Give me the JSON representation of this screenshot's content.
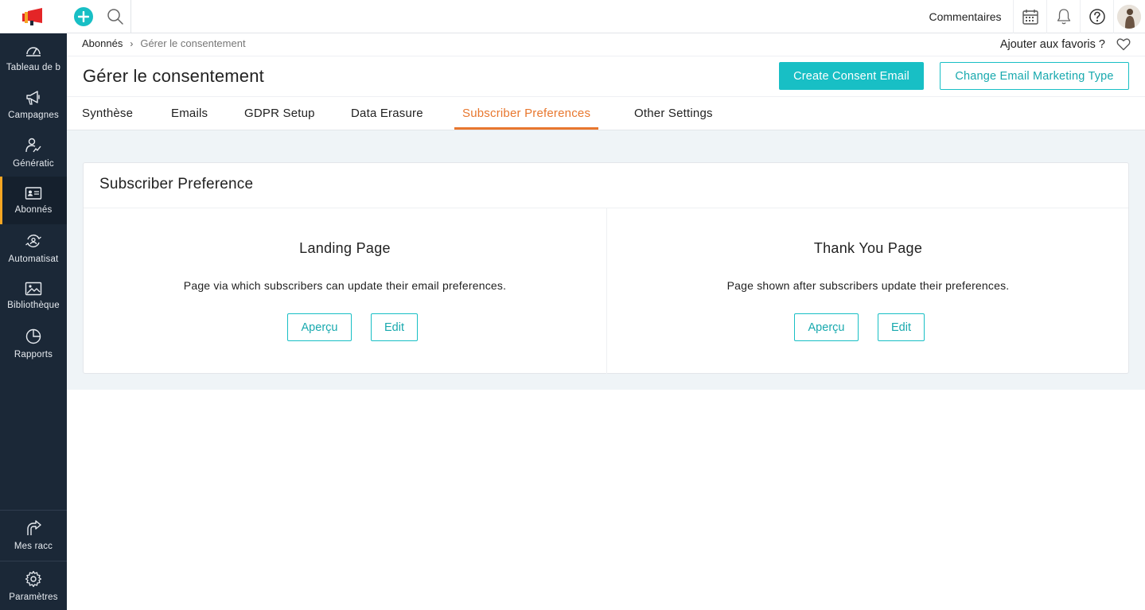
{
  "topbar": {
    "feedback_label": "Commentaires"
  },
  "sidebar": {
    "items": [
      {
        "label": "Tableau de b",
        "icon": "dashboard-icon"
      },
      {
        "label": "Campagnes",
        "icon": "megaphone-icon"
      },
      {
        "label": "Génératic",
        "icon": "lead-generation-icon"
      },
      {
        "label": "Abonnés",
        "icon": "contact-card-icon",
        "active": true
      },
      {
        "label": "Automatisat",
        "icon": "automation-icon"
      },
      {
        "label": "Bibliothèque",
        "icon": "image-icon"
      },
      {
        "label": "Rapports",
        "icon": "pie-chart-icon"
      }
    ],
    "shortcuts_label": "Mes racc",
    "settings_label": "Paramètres"
  },
  "breadcrumb": {
    "parent": "Abonnés",
    "current": "Gérer le consentement"
  },
  "favorites_label": "Ajouter aux favoris ?",
  "page_title": "Gérer le consentement",
  "actions": {
    "create_consent_email": "Create Consent Email",
    "change_marketing_type": "Change Email Marketing Type"
  },
  "tabs": [
    {
      "label": "Synthèse"
    },
    {
      "label": "Emails"
    },
    {
      "label": "GDPR Setup"
    },
    {
      "label": "Data Erasure"
    },
    {
      "label": "Subscriber Preferences",
      "active": true
    },
    {
      "label": "Other Settings"
    }
  ],
  "card": {
    "title": "Subscriber Preference",
    "landing": {
      "title": "Landing Page",
      "description": "Page via which subscribers can update their email preferences.",
      "preview_label": "Aperçu",
      "edit_label": "Edit"
    },
    "thankyou": {
      "title": "Thank You Page",
      "description": "Page shown after subscribers update their preferences.",
      "preview_label": "Aperçu",
      "edit_label": "Edit"
    }
  },
  "colors": {
    "accent": "#18bfc5",
    "active_tab": "#e8772e",
    "sidebar_bg": "#1b2837",
    "sidebar_active_marker": "#f5a623"
  }
}
